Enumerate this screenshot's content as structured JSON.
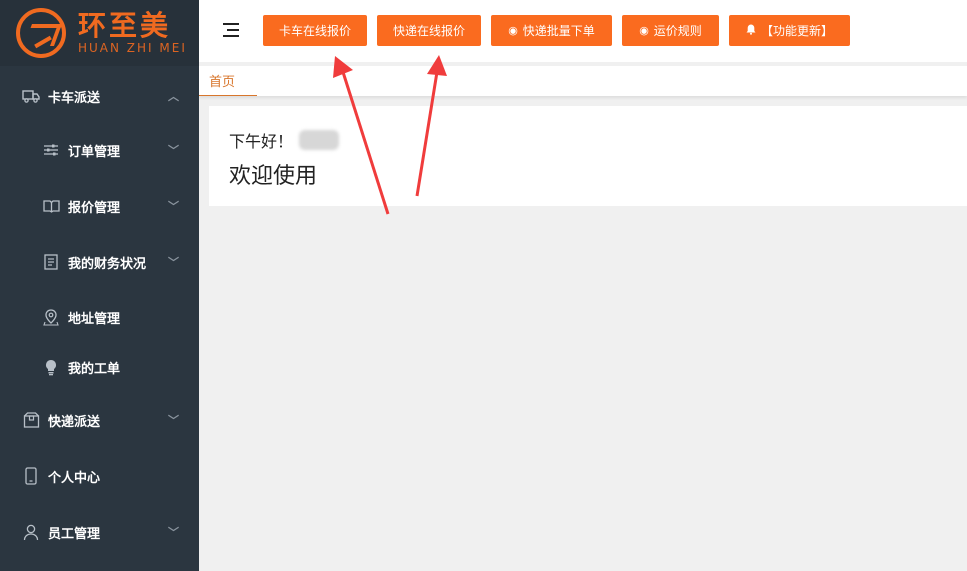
{
  "logo": {
    "name_cn": "环至美",
    "name_en": "HUAN ZHI MEI"
  },
  "sidebar": {
    "items": [
      {
        "label": "卡车派送",
        "icon": "truck-icon"
      },
      {
        "label": "订单管理",
        "icon": "sliders-icon"
      },
      {
        "label": "报价管理",
        "icon": "book-icon"
      },
      {
        "label": "我的财务状况",
        "icon": "document-icon"
      },
      {
        "label": "地址管理",
        "icon": "map-pin-icon"
      },
      {
        "label": "我的工单",
        "icon": "lightbulb-icon"
      },
      {
        "label": "快递派送",
        "icon": "package-icon"
      },
      {
        "label": "个人中心",
        "icon": "mobile-icon"
      },
      {
        "label": "员工管理",
        "icon": "user-icon"
      }
    ]
  },
  "header": {
    "buttons": [
      {
        "label": "卡车在线报价"
      },
      {
        "label": "快递在线报价"
      },
      {
        "label": "快递批量下单",
        "icon": "eye-icon"
      },
      {
        "label": "运价规则",
        "icon": "eye-icon"
      },
      {
        "label": "【功能更新】",
        "icon": "bell-icon"
      }
    ]
  },
  "tabs": [
    {
      "label": "首页"
    }
  ],
  "main": {
    "greeting": "下午好！",
    "welcome": "欢迎使用"
  },
  "colors": {
    "accent": "#fa6b1f",
    "sidebar": "#2b3640",
    "annotation": "#f03c3c"
  }
}
